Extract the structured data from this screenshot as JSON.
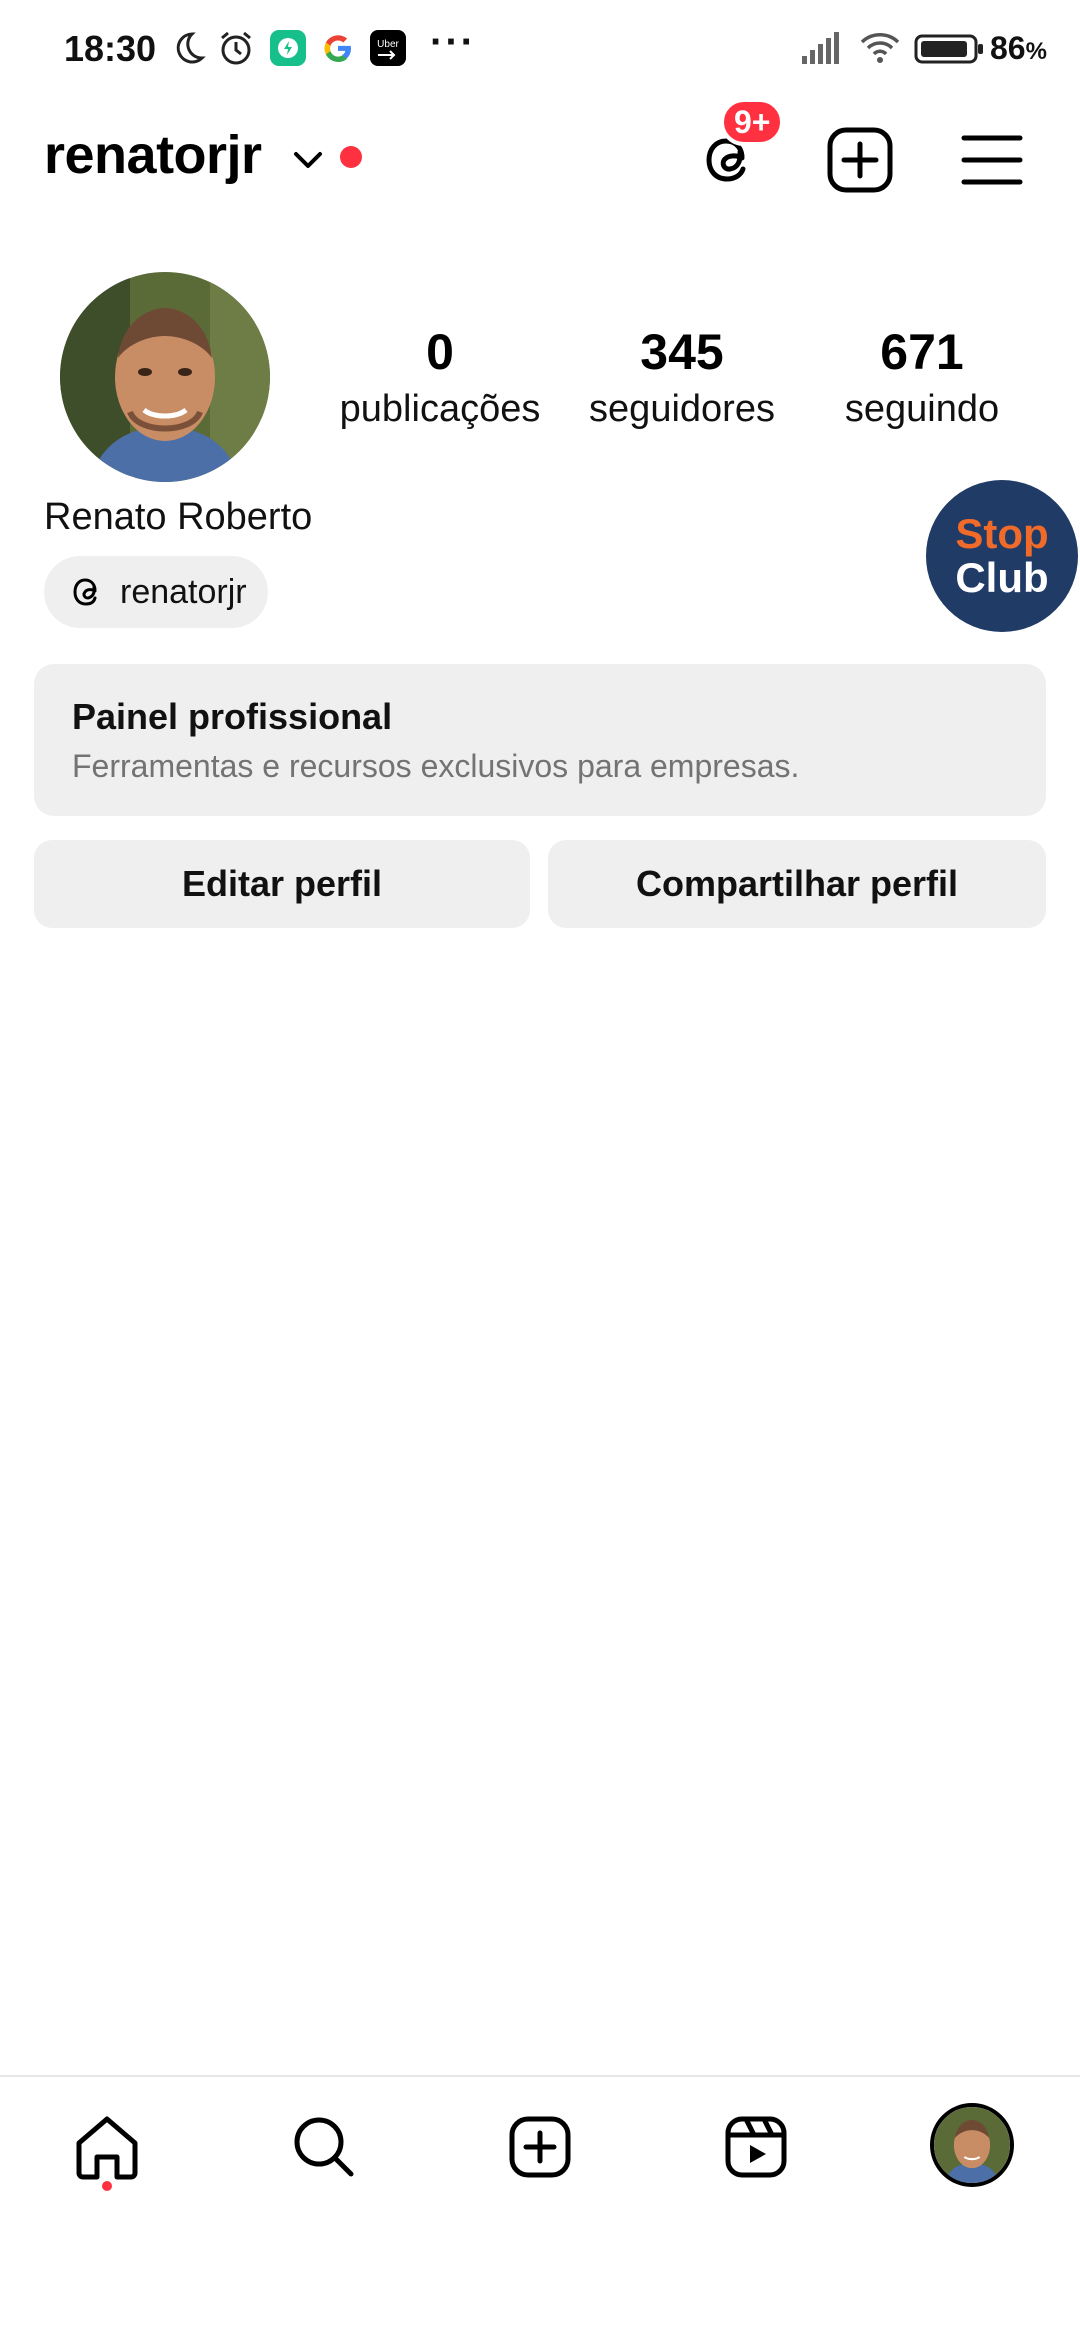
{
  "status_bar": {
    "time": "18:30",
    "battery_pct": "86",
    "battery_unit": "%",
    "notification_icons": [
      "moon-icon",
      "alarm-icon",
      "shield-app-icon",
      "google-icon",
      "uber-icon"
    ],
    "overflow": "···"
  },
  "header": {
    "username": "renatorjr",
    "threads_badge": "9+"
  },
  "profile": {
    "full_name": "Renato Roberto",
    "threads_handle": "renatorjr",
    "stats": [
      {
        "value": "0",
        "label": "publicações"
      },
      {
        "value": "345",
        "label": "seguidores"
      },
      {
        "value": "671",
        "label": "seguindo"
      }
    ]
  },
  "floating_bubble": {
    "line1": "Stop",
    "line2": "Club"
  },
  "pro_panel": {
    "title": "Painel profissional",
    "subtitle": "Ferramentas e recursos exclusivos para empresas."
  },
  "actions": {
    "edit": "Editar perfil",
    "share": "Compartilhar perfil"
  },
  "colors": {
    "accent_red": "#ff3040",
    "chip_bg": "#efefef",
    "muted_text": "#737373"
  }
}
